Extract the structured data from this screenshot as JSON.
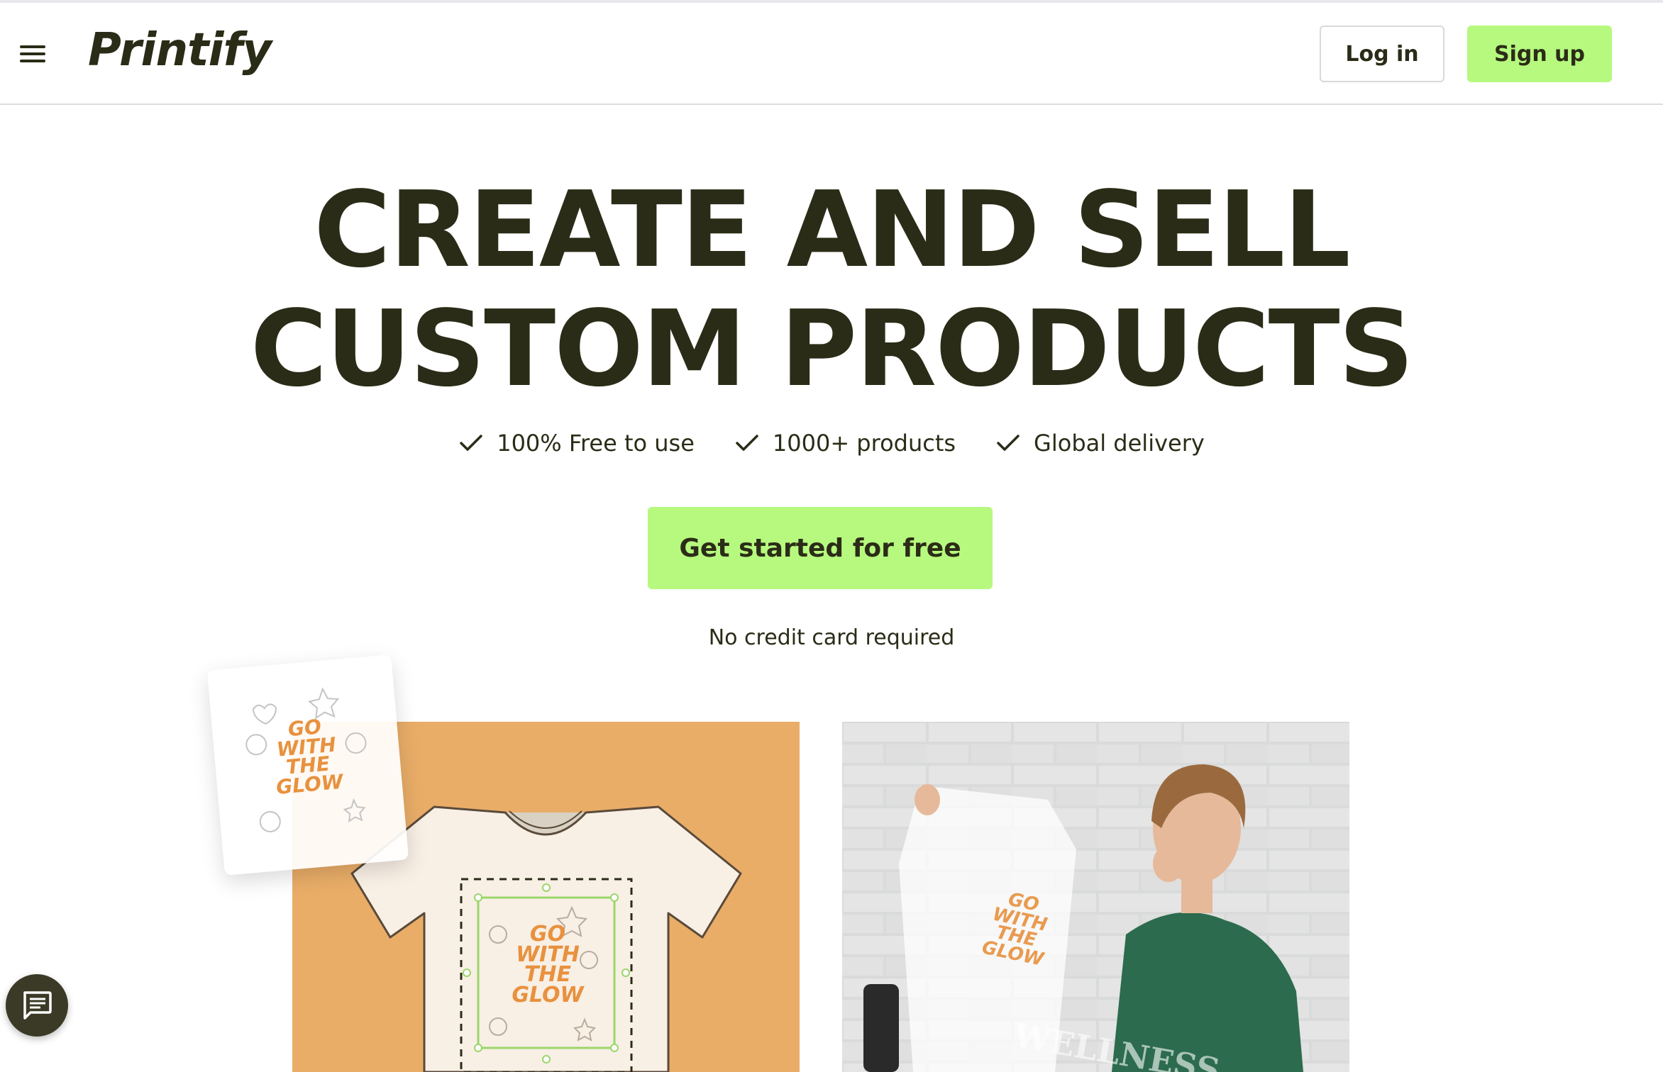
{
  "header": {
    "logo_text": "Printify",
    "login_label": "Log in",
    "signup_label": "Sign up"
  },
  "hero": {
    "title_line1": "CREATE AND SELL",
    "title_line2": "CUSTOM PRODUCTS",
    "features": [
      "100% Free to use",
      "1000+ products",
      "Global delivery"
    ],
    "cta_label": "Get started for free",
    "note": "No credit card required"
  },
  "artwork": {
    "design_text": [
      "GO",
      "WITH",
      "THE",
      "GLOW"
    ],
    "sweatshirt_text": "WELLNESS"
  },
  "colors": {
    "accent": "#b6f97e",
    "text": "#2b2c17",
    "panel": "#e9ad68",
    "design_orange": "#e8913e"
  },
  "icons": {
    "menu": "hamburger-menu-icon",
    "check": "check-icon",
    "chat": "chat-icon"
  }
}
